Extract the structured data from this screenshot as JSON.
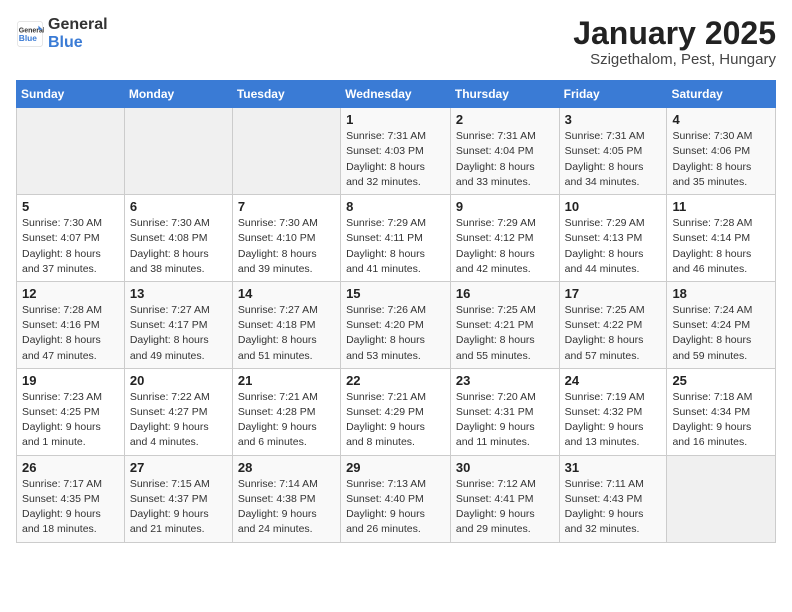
{
  "header": {
    "logo_line1": "General",
    "logo_line2": "Blue",
    "title": "January 2025",
    "subtitle": "Szigethalom, Pest, Hungary"
  },
  "weekdays": [
    "Sunday",
    "Monday",
    "Tuesday",
    "Wednesday",
    "Thursday",
    "Friday",
    "Saturday"
  ],
  "weeks": [
    [
      {
        "day": "",
        "info": ""
      },
      {
        "day": "",
        "info": ""
      },
      {
        "day": "",
        "info": ""
      },
      {
        "day": "1",
        "info": "Sunrise: 7:31 AM\nSunset: 4:03 PM\nDaylight: 8 hours and 32 minutes."
      },
      {
        "day": "2",
        "info": "Sunrise: 7:31 AM\nSunset: 4:04 PM\nDaylight: 8 hours and 33 minutes."
      },
      {
        "day": "3",
        "info": "Sunrise: 7:31 AM\nSunset: 4:05 PM\nDaylight: 8 hours and 34 minutes."
      },
      {
        "day": "4",
        "info": "Sunrise: 7:30 AM\nSunset: 4:06 PM\nDaylight: 8 hours and 35 minutes."
      }
    ],
    [
      {
        "day": "5",
        "info": "Sunrise: 7:30 AM\nSunset: 4:07 PM\nDaylight: 8 hours and 37 minutes."
      },
      {
        "day": "6",
        "info": "Sunrise: 7:30 AM\nSunset: 4:08 PM\nDaylight: 8 hours and 38 minutes."
      },
      {
        "day": "7",
        "info": "Sunrise: 7:30 AM\nSunset: 4:10 PM\nDaylight: 8 hours and 39 minutes."
      },
      {
        "day": "8",
        "info": "Sunrise: 7:29 AM\nSunset: 4:11 PM\nDaylight: 8 hours and 41 minutes."
      },
      {
        "day": "9",
        "info": "Sunrise: 7:29 AM\nSunset: 4:12 PM\nDaylight: 8 hours and 42 minutes."
      },
      {
        "day": "10",
        "info": "Sunrise: 7:29 AM\nSunset: 4:13 PM\nDaylight: 8 hours and 44 minutes."
      },
      {
        "day": "11",
        "info": "Sunrise: 7:28 AM\nSunset: 4:14 PM\nDaylight: 8 hours and 46 minutes."
      }
    ],
    [
      {
        "day": "12",
        "info": "Sunrise: 7:28 AM\nSunset: 4:16 PM\nDaylight: 8 hours and 47 minutes."
      },
      {
        "day": "13",
        "info": "Sunrise: 7:27 AM\nSunset: 4:17 PM\nDaylight: 8 hours and 49 minutes."
      },
      {
        "day": "14",
        "info": "Sunrise: 7:27 AM\nSunset: 4:18 PM\nDaylight: 8 hours and 51 minutes."
      },
      {
        "day": "15",
        "info": "Sunrise: 7:26 AM\nSunset: 4:20 PM\nDaylight: 8 hours and 53 minutes."
      },
      {
        "day": "16",
        "info": "Sunrise: 7:25 AM\nSunset: 4:21 PM\nDaylight: 8 hours and 55 minutes."
      },
      {
        "day": "17",
        "info": "Sunrise: 7:25 AM\nSunset: 4:22 PM\nDaylight: 8 hours and 57 minutes."
      },
      {
        "day": "18",
        "info": "Sunrise: 7:24 AM\nSunset: 4:24 PM\nDaylight: 8 hours and 59 minutes."
      }
    ],
    [
      {
        "day": "19",
        "info": "Sunrise: 7:23 AM\nSunset: 4:25 PM\nDaylight: 9 hours and 1 minute."
      },
      {
        "day": "20",
        "info": "Sunrise: 7:22 AM\nSunset: 4:27 PM\nDaylight: 9 hours and 4 minutes."
      },
      {
        "day": "21",
        "info": "Sunrise: 7:21 AM\nSunset: 4:28 PM\nDaylight: 9 hours and 6 minutes."
      },
      {
        "day": "22",
        "info": "Sunrise: 7:21 AM\nSunset: 4:29 PM\nDaylight: 9 hours and 8 minutes."
      },
      {
        "day": "23",
        "info": "Sunrise: 7:20 AM\nSunset: 4:31 PM\nDaylight: 9 hours and 11 minutes."
      },
      {
        "day": "24",
        "info": "Sunrise: 7:19 AM\nSunset: 4:32 PM\nDaylight: 9 hours and 13 minutes."
      },
      {
        "day": "25",
        "info": "Sunrise: 7:18 AM\nSunset: 4:34 PM\nDaylight: 9 hours and 16 minutes."
      }
    ],
    [
      {
        "day": "26",
        "info": "Sunrise: 7:17 AM\nSunset: 4:35 PM\nDaylight: 9 hours and 18 minutes."
      },
      {
        "day": "27",
        "info": "Sunrise: 7:15 AM\nSunset: 4:37 PM\nDaylight: 9 hours and 21 minutes."
      },
      {
        "day": "28",
        "info": "Sunrise: 7:14 AM\nSunset: 4:38 PM\nDaylight: 9 hours and 24 minutes."
      },
      {
        "day": "29",
        "info": "Sunrise: 7:13 AM\nSunset: 4:40 PM\nDaylight: 9 hours and 26 minutes."
      },
      {
        "day": "30",
        "info": "Sunrise: 7:12 AM\nSunset: 4:41 PM\nDaylight: 9 hours and 29 minutes."
      },
      {
        "day": "31",
        "info": "Sunrise: 7:11 AM\nSunset: 4:43 PM\nDaylight: 9 hours and 32 minutes."
      },
      {
        "day": "",
        "info": ""
      }
    ]
  ]
}
